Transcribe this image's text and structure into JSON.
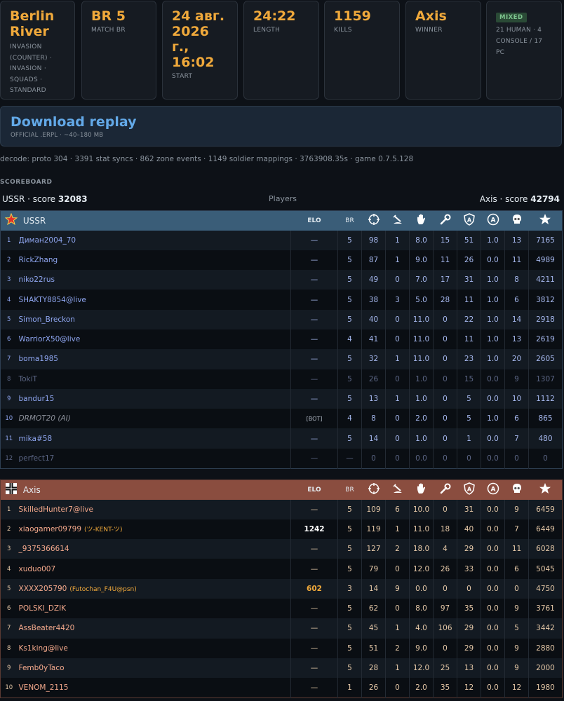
{
  "cards": {
    "map": {
      "title": "Berlin River",
      "sub": [
        "INVASION",
        "(COUNTER) ·",
        "INVASION ·",
        "SQUADS ·",
        "STANDARD"
      ]
    },
    "br": {
      "value": "BR 5",
      "label": "MATCH BR"
    },
    "start": {
      "value": "24 авг. 2026 г., 16:02",
      "label": "START"
    },
    "length": {
      "value": "24:22",
      "label": "LENGTH"
    },
    "kills": {
      "value": "1159",
      "label": "KILLS"
    },
    "winner": {
      "value": "Axis",
      "label": "WINNER"
    },
    "mix": {
      "badge": "MIXED",
      "line1": "21 HUMAN · 4",
      "line2": "CONSOLE / 17 PC"
    }
  },
  "download": {
    "title": "Download replay",
    "sub": "OFFICIAL .ERPL · ~40–180 MB"
  },
  "decode_line": "decode: proto 304 · 3391 stat syncs · 862 zone events · 1149 soldier mappings · 3763908.35s · game 0.7.5.128",
  "scoreboard_label": "SCOREBOARD",
  "scoreline": {
    "left_team": "USSR · score",
    "left_score": "32083",
    "center": "Players",
    "right_team": "Axis · score",
    "right_score": "42794"
  },
  "headers": {
    "elo": "ELO",
    "br": "BR"
  },
  "icons": [
    "crosshair-icon",
    "grenade-icon",
    "hand-icon",
    "wrench-icon",
    "shield-a-icon",
    "circle-a-icon",
    "skull-icon",
    "star-icon"
  ],
  "colors": {
    "accent": "#f0a93b",
    "ussr_header": "#3a5d78",
    "axis_header": "#8a4d3f",
    "link": "#63a9e8"
  },
  "ussr": {
    "name": "USSR",
    "rows": [
      {
        "n": "1",
        "name": "Диман2004_70",
        "elo": "—",
        "br": "5",
        "c": [
          "98",
          "1",
          "8.0",
          "15",
          "51",
          "1.0",
          "13",
          "7165"
        ]
      },
      {
        "n": "2",
        "name": "RickZhang",
        "elo": "—",
        "br": "5",
        "c": [
          "87",
          "1",
          "9.0",
          "11",
          "26",
          "0.0",
          "11",
          "4989"
        ]
      },
      {
        "n": "3",
        "name": "niko22rus",
        "elo": "—",
        "br": "5",
        "c": [
          "49",
          "0",
          "7.0",
          "17",
          "31",
          "1.0",
          "8",
          "4211"
        ]
      },
      {
        "n": "4",
        "name": "SHAKTY8854@live",
        "elo": "—",
        "br": "5",
        "c": [
          "38",
          "3",
          "5.0",
          "28",
          "11",
          "1.0",
          "6",
          "3812"
        ]
      },
      {
        "n": "5",
        "name": "Simon_Breckon",
        "elo": "—",
        "br": "5",
        "c": [
          "40",
          "0",
          "11.0",
          "0",
          "22",
          "1.0",
          "14",
          "2918"
        ]
      },
      {
        "n": "6",
        "name": "WarriorX50@live",
        "elo": "—",
        "br": "4",
        "c": [
          "41",
          "0",
          "11.0",
          "0",
          "11",
          "1.0",
          "13",
          "2619"
        ]
      },
      {
        "n": "7",
        "name": "boma1985",
        "elo": "—",
        "br": "5",
        "c": [
          "32",
          "1",
          "11.0",
          "0",
          "23",
          "1.0",
          "20",
          "2605"
        ]
      },
      {
        "n": "8",
        "name": "TokiT",
        "elo": "—",
        "br": "5",
        "c": [
          "26",
          "0",
          "1.0",
          "0",
          "15",
          "0.0",
          "9",
          "1307"
        ]
      },
      {
        "n": "9",
        "name": "bandur15",
        "elo": "—",
        "br": "5",
        "c": [
          "13",
          "1",
          "1.0",
          "0",
          "5",
          "0.0",
          "10",
          "1112"
        ]
      },
      {
        "n": "10",
        "name": "DRMOT20 (AI)",
        "elo": "[BOT]",
        "br": "4",
        "c": [
          "8",
          "0",
          "2.0",
          "0",
          "5",
          "1.0",
          "6",
          "865"
        ]
      },
      {
        "n": "11",
        "name": "mika#58",
        "elo": "—",
        "br": "5",
        "c": [
          "14",
          "0",
          "1.0",
          "0",
          "1",
          "0.0",
          "7",
          "480"
        ]
      },
      {
        "n": "12",
        "name": "perfect17",
        "elo": "—",
        "br": "—",
        "c": [
          "0",
          "0",
          "0.0",
          "0",
          "0",
          "0.0",
          "0",
          "0"
        ]
      }
    ]
  },
  "axis": {
    "name": "Axis",
    "rows": [
      {
        "n": "1",
        "name": "SkilledHunter7@live",
        "tag": "",
        "elo": "—",
        "br": "5",
        "c": [
          "109",
          "6",
          "10.0",
          "0",
          "31",
          "0.0",
          "9",
          "6459"
        ]
      },
      {
        "n": "2",
        "name": "xiaogamer09799",
        "tag": "(ツ-KENT-ツ)",
        "elo": "1242",
        "br": "5",
        "c": [
          "119",
          "1",
          "11.0",
          "18",
          "40",
          "0.0",
          "7",
          "6449"
        ]
      },
      {
        "n": "3",
        "name": "_9375366614",
        "tag": "",
        "elo": "—",
        "br": "5",
        "c": [
          "127",
          "2",
          "18.0",
          "4",
          "29",
          "0.0",
          "11",
          "6028"
        ]
      },
      {
        "n": "4",
        "name": "xuduo007",
        "tag": "",
        "elo": "—",
        "br": "5",
        "c": [
          "79",
          "0",
          "12.0",
          "26",
          "33",
          "0.0",
          "6",
          "5045"
        ]
      },
      {
        "n": "5",
        "name": "XXXX205790",
        "tag": "(Futochan_F4U@psn)",
        "elo": "602",
        "br": "3",
        "c": [
          "14",
          "9",
          "0.0",
          "0",
          "0",
          "0.0",
          "0",
          "4750"
        ]
      },
      {
        "n": "6",
        "name": "POLSKI_DZIK",
        "tag": "",
        "elo": "—",
        "br": "5",
        "c": [
          "62",
          "0",
          "8.0",
          "97",
          "35",
          "0.0",
          "9",
          "3761"
        ]
      },
      {
        "n": "7",
        "name": "AssBeater4420",
        "tag": "",
        "elo": "—",
        "br": "5",
        "c": [
          "45",
          "1",
          "4.0",
          "106",
          "29",
          "0.0",
          "5",
          "3442"
        ]
      },
      {
        "n": "8",
        "name": "Ks1king@live",
        "tag": "",
        "elo": "—",
        "br": "5",
        "c": [
          "51",
          "2",
          "9.0",
          "0",
          "29",
          "0.0",
          "9",
          "2880"
        ]
      },
      {
        "n": "9",
        "name": "Femb0yTaco",
        "tag": "",
        "elo": "—",
        "br": "5",
        "c": [
          "28",
          "1",
          "12.0",
          "25",
          "13",
          "0.0",
          "9",
          "2000"
        ]
      },
      {
        "n": "10",
        "name": "VENOM_2115",
        "tag": "",
        "elo": "—",
        "br": "1",
        "c": [
          "26",
          "0",
          "2.0",
          "35",
          "12",
          "0.0",
          "12",
          "1980"
        ]
      }
    ]
  }
}
